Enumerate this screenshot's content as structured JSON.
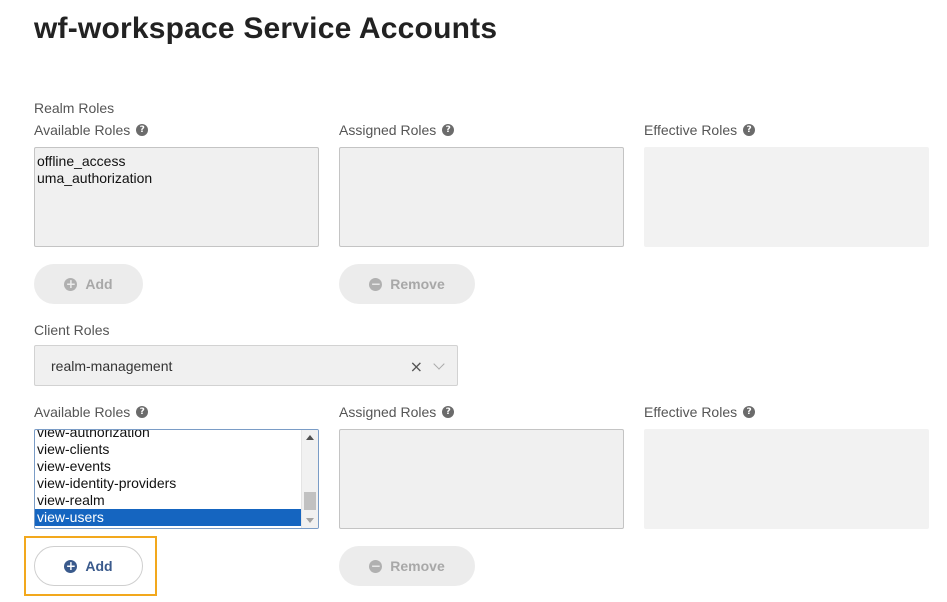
{
  "page": {
    "title": "wf-workspace Service Accounts"
  },
  "realm_roles": {
    "section_label": "Realm Roles",
    "available_label": "Available Roles",
    "assigned_label": "Assigned Roles",
    "effective_label": "Effective Roles",
    "available_options": [
      "offline_access",
      "uma_authorization"
    ],
    "add_label": "Add",
    "remove_label": "Remove"
  },
  "client_roles": {
    "section_label": "Client Roles",
    "selected_client": "realm-management",
    "available_label": "Available Roles",
    "assigned_label": "Assigned Roles",
    "effective_label": "Effective Roles",
    "available_options": [
      "view-authorization",
      "view-clients",
      "view-events",
      "view-identity-providers",
      "view-realm",
      "view-users"
    ],
    "selected_option": "view-users",
    "add_label": "Add",
    "remove_label": "Remove"
  },
  "icons": {
    "help": "question-circle-icon",
    "add": "plus-circle-icon",
    "remove": "minus-circle-icon",
    "clear": "clear-x-icon",
    "chevron": "chevron-down-icon"
  },
  "colors": {
    "selection": "#1565c0",
    "highlight": "#f2a81d",
    "active_button_text": "#3a5a8c"
  }
}
